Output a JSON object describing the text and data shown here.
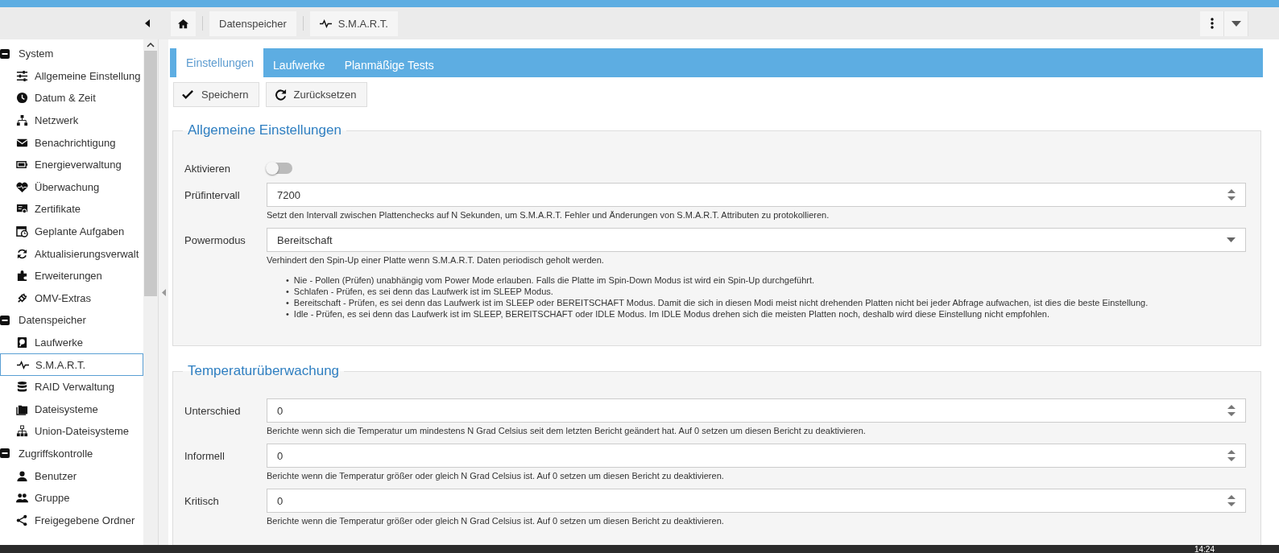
{
  "header": {
    "breadcrumbs": [
      {
        "kind": "home"
      },
      {
        "kind": "text",
        "label": "Datenspeicher"
      },
      {
        "kind": "pulse",
        "label": "S.M.A.R.T."
      }
    ]
  },
  "sidebar": {
    "groups": [
      {
        "label": "System",
        "expanded": true,
        "children": [
          {
            "kind": "sliders",
            "label": "Allgemeine Einstellung",
            "selected": false
          },
          {
            "kind": "clock",
            "label": "Datum & Zeit",
            "selected": false
          },
          {
            "kind": "network",
            "label": "Netzwerk",
            "selected": false
          },
          {
            "kind": "mail",
            "label": "Benachrichtigung",
            "selected": false
          },
          {
            "kind": "battery",
            "label": "Energieverwaltung",
            "selected": false
          },
          {
            "kind": "heart",
            "label": "Überwachung",
            "selected": false
          },
          {
            "kind": "certificate",
            "label": "Zertifikate",
            "selected": false
          },
          {
            "kind": "calendar",
            "label": "Geplante Aufgaben",
            "selected": false
          },
          {
            "kind": "refresh",
            "label": "Aktualisierungsverwalt",
            "selected": false
          },
          {
            "kind": "puzzle",
            "label": "Erweiterungen",
            "selected": false
          },
          {
            "kind": "plug",
            "label": "OMV-Extras",
            "selected": false
          }
        ]
      },
      {
        "label": "Datenspeicher",
        "expanded": true,
        "children": [
          {
            "kind": "disk",
            "label": "Laufwerke",
            "selected": false
          },
          {
            "kind": "pulse",
            "label": "S.M.A.R.T.",
            "selected": true
          },
          {
            "kind": "database",
            "label": "RAID Verwaltung",
            "selected": false
          },
          {
            "kind": "folder",
            "label": "Dateisysteme",
            "selected": false
          },
          {
            "kind": "hierarchy",
            "label": "Union-Dateisysteme",
            "selected": false
          }
        ]
      },
      {
        "label": "Zugriffskontrolle",
        "expanded": true,
        "children": [
          {
            "kind": "user",
            "label": "Benutzer",
            "selected": false
          },
          {
            "kind": "users",
            "label": "Gruppe",
            "selected": false
          },
          {
            "kind": "share",
            "label": "Freigegebene Ordner",
            "selected": false
          }
        ]
      }
    ]
  },
  "tabs": [
    {
      "label": "Einstellungen",
      "selected": true
    },
    {
      "label": "Laufwerke",
      "selected": false
    },
    {
      "label": "Planmäßige Tests",
      "selected": false
    }
  ],
  "toolbar": {
    "buttons": [
      {
        "kind": "check",
        "label": "Speichern"
      },
      {
        "kind": "reset",
        "label": "Zurücksetzen"
      }
    ]
  },
  "sections": [
    {
      "title": "Allgemeine Einstellungen",
      "fields": [
        {
          "kind": "switch",
          "label": "Aktivieren",
          "on": false
        },
        {
          "kind": "number",
          "label": "Prüfintervall",
          "value": "7200",
          "hint": "Setzt den Intervall zwischen Plattenchecks auf N Sekunden, um S.M.A.R.T. Fehler und Änderungen von S.M.A.R.T. Attributen zu protokollieren."
        },
        {
          "kind": "select",
          "label": "Powermodus",
          "value": "Bereitschaft",
          "hint": "Verhindert den Spin-Up einer Platte wenn S.M.A.R.T. Daten periodisch geholt werden.",
          "bullets": [
            {
              "marker": "•",
              "text": "Nie - Pollen (Prüfen) unabhängig vom Power Mode erlauben. Falls die Platte im Spin-Down Modus ist wird ein Spin-Up durchgeführt."
            },
            {
              "marker": "•",
              "text": "Schlafen - Prüfen, es sei denn das Laufwerk ist im SLEEP Modus."
            },
            {
              "marker": "•",
              "text": "Bereitschaft - Prüfen, es sei denn das Laufwerk ist im SLEEP oder BEREITSCHAFT Modus. Damit die sich in diesen Modi meist nicht drehenden Platten nicht bei jeder Abfrage aufwachen, ist dies die beste Einstellung."
            },
            {
              "marker": "•",
              "text": "Idle - Prüfen, es sei denn das Laufwerk ist im SLEEP, BEREITSCHAFT oder IDLE Modus. Im IDLE Modus drehen sich die meisten Platten noch, deshalb wird diese Einstellung nicht empfohlen."
            }
          ]
        }
      ]
    },
    {
      "title": "Temperaturüberwachung",
      "fields": [
        {
          "kind": "number",
          "label": "Unterschied",
          "value": "0",
          "hint": "Berichte wenn sich die Temperatur um mindestens N Grad Celsius seit dem letzten Bericht geändert hat. Auf 0 setzen um diesen Bericht zu deaktivieren."
        },
        {
          "kind": "number",
          "label": "Informell",
          "value": "0",
          "hint": "Berichte wenn die Temperatur größer oder gleich N Grad Celsius ist. Auf 0 setzen um diesen Bericht zu deaktivieren."
        },
        {
          "kind": "number",
          "label": "Kritisch",
          "value": "0",
          "hint": "Berichte wenn die Temperatur größer oder gleich N Grad Celsius ist. Auf 0 setzen um diesen Bericht zu deaktivieren."
        }
      ]
    }
  ],
  "taskbar": {
    "clock": "14:24"
  }
}
